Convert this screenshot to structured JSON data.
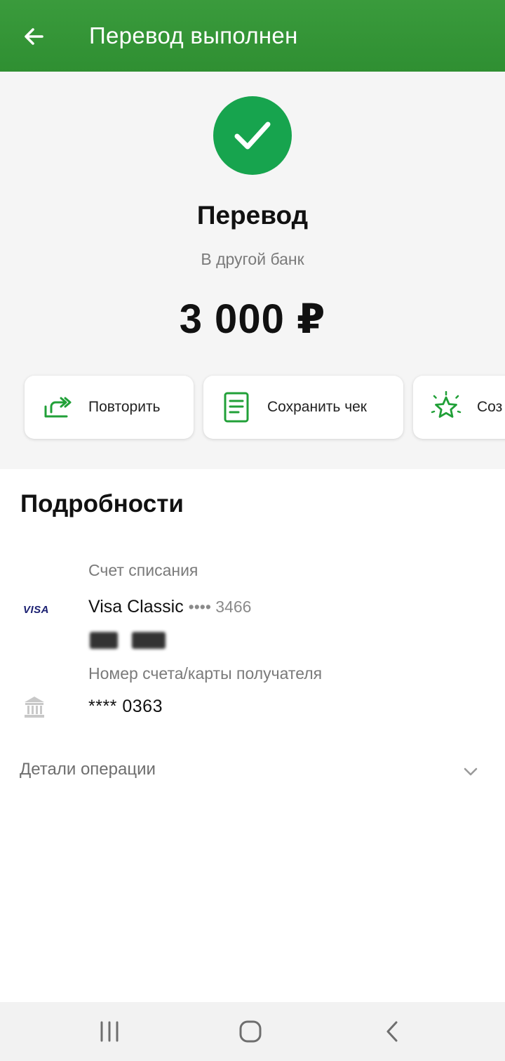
{
  "header": {
    "title": "Перевод выполнен"
  },
  "summary": {
    "title": "Перевод",
    "subtitle": "В другой банк",
    "amount": "3 000 ₽"
  },
  "actions": [
    {
      "label": "Повторить",
      "icon": "repeat-icon"
    },
    {
      "label": "Сохранить чек",
      "icon": "receipt-icon"
    },
    {
      "label": "Соз",
      "icon": "star-icon"
    }
  ],
  "details": {
    "title": "Подробности",
    "debit_account": {
      "label": "Счет списания",
      "card_name": "Visa Classic",
      "card_mask": "•••• 3466",
      "logo": "VISA"
    },
    "recipient": {
      "label": "Номер счета/карты получателя",
      "value": "**** 0363",
      "icon": "bank-icon"
    }
  },
  "operation_details": {
    "label": "Детали операции"
  },
  "colors": {
    "header_green": "#2f8f32",
    "success_green": "#17a44e",
    "action_icon_green": "#21a038"
  }
}
